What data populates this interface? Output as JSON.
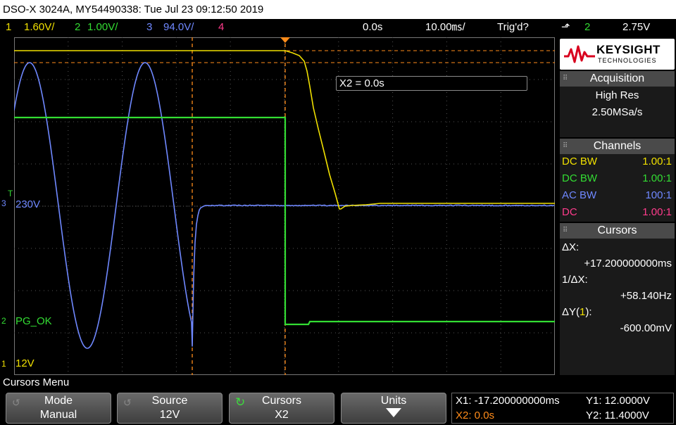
{
  "title": "DSO-X 3024A, MY54490338: Tue Jul 23 09:12:50 2019",
  "status": {
    "ch1_num": "1",
    "ch1_scale": "1.60V/",
    "ch2_num": "2",
    "ch2_scale": "1.00V/",
    "ch3_num": "3",
    "ch3_scale": "94.0V/",
    "ch4_num": "4",
    "time_delay": "0.0s",
    "time_scale": "10.00㎳/",
    "trigger_state": "Trig'd?",
    "trigger_source": "2",
    "trigger_level": "2.75V"
  },
  "channel_labels": {
    "ch1_marker": "1",
    "ch1_label": "12V",
    "ch2_marker": "2",
    "ch2_label": "PG_OK",
    "ch3_marker": "3",
    "ch3_label": "230V",
    "trigger_marker": "T"
  },
  "cursor_readout": "X2 = 0.0s",
  "panel": {
    "brand": "KEYSIGHT",
    "brand_sub": "TECHNOLOGIES",
    "acquisition_title": "Acquisition",
    "acq_mode": "High Res",
    "acq_rate": "2.50MSa/s",
    "channels_title": "Channels",
    "channels": [
      {
        "coupling": "DC BW",
        "probe": "1.00:1"
      },
      {
        "coupling": "DC BW",
        "probe": "1.00:1"
      },
      {
        "coupling": "AC BW",
        "probe": "100:1"
      },
      {
        "coupling": "DC",
        "probe": "1.00:1"
      }
    ],
    "cursors_title": "Cursors",
    "dx_label": "ΔX:",
    "dx_value": "+17.200000000ms",
    "inv_dx_label": "1/ΔX:",
    "inv_dx_value": "+58.140Hz",
    "dy_label_pre": "ΔY(",
    "dy_label_ch": "1",
    "dy_label_post": "):",
    "dy_value": "-600.00mV"
  },
  "menu_title": "Cursors Menu",
  "softkeys": [
    {
      "title": "Mode",
      "value": "Manual"
    },
    {
      "title": "Source",
      "value": "12V"
    },
    {
      "title": "Cursors",
      "value": "X2"
    },
    {
      "title": "Units",
      "value": ""
    }
  ],
  "readouts": {
    "x1": "X1: -17.200000000ms",
    "x2": "X2: 0.0s",
    "y1": "Y1: 12.0000V",
    "y2": "Y2: 11.4000V"
  },
  "colors": {
    "ch1": "#f0e000",
    "ch2": "#33dd33",
    "ch3": "#6f88ff",
    "ch4": "#ff3c8c",
    "cursor": "#ff8c1a"
  }
}
